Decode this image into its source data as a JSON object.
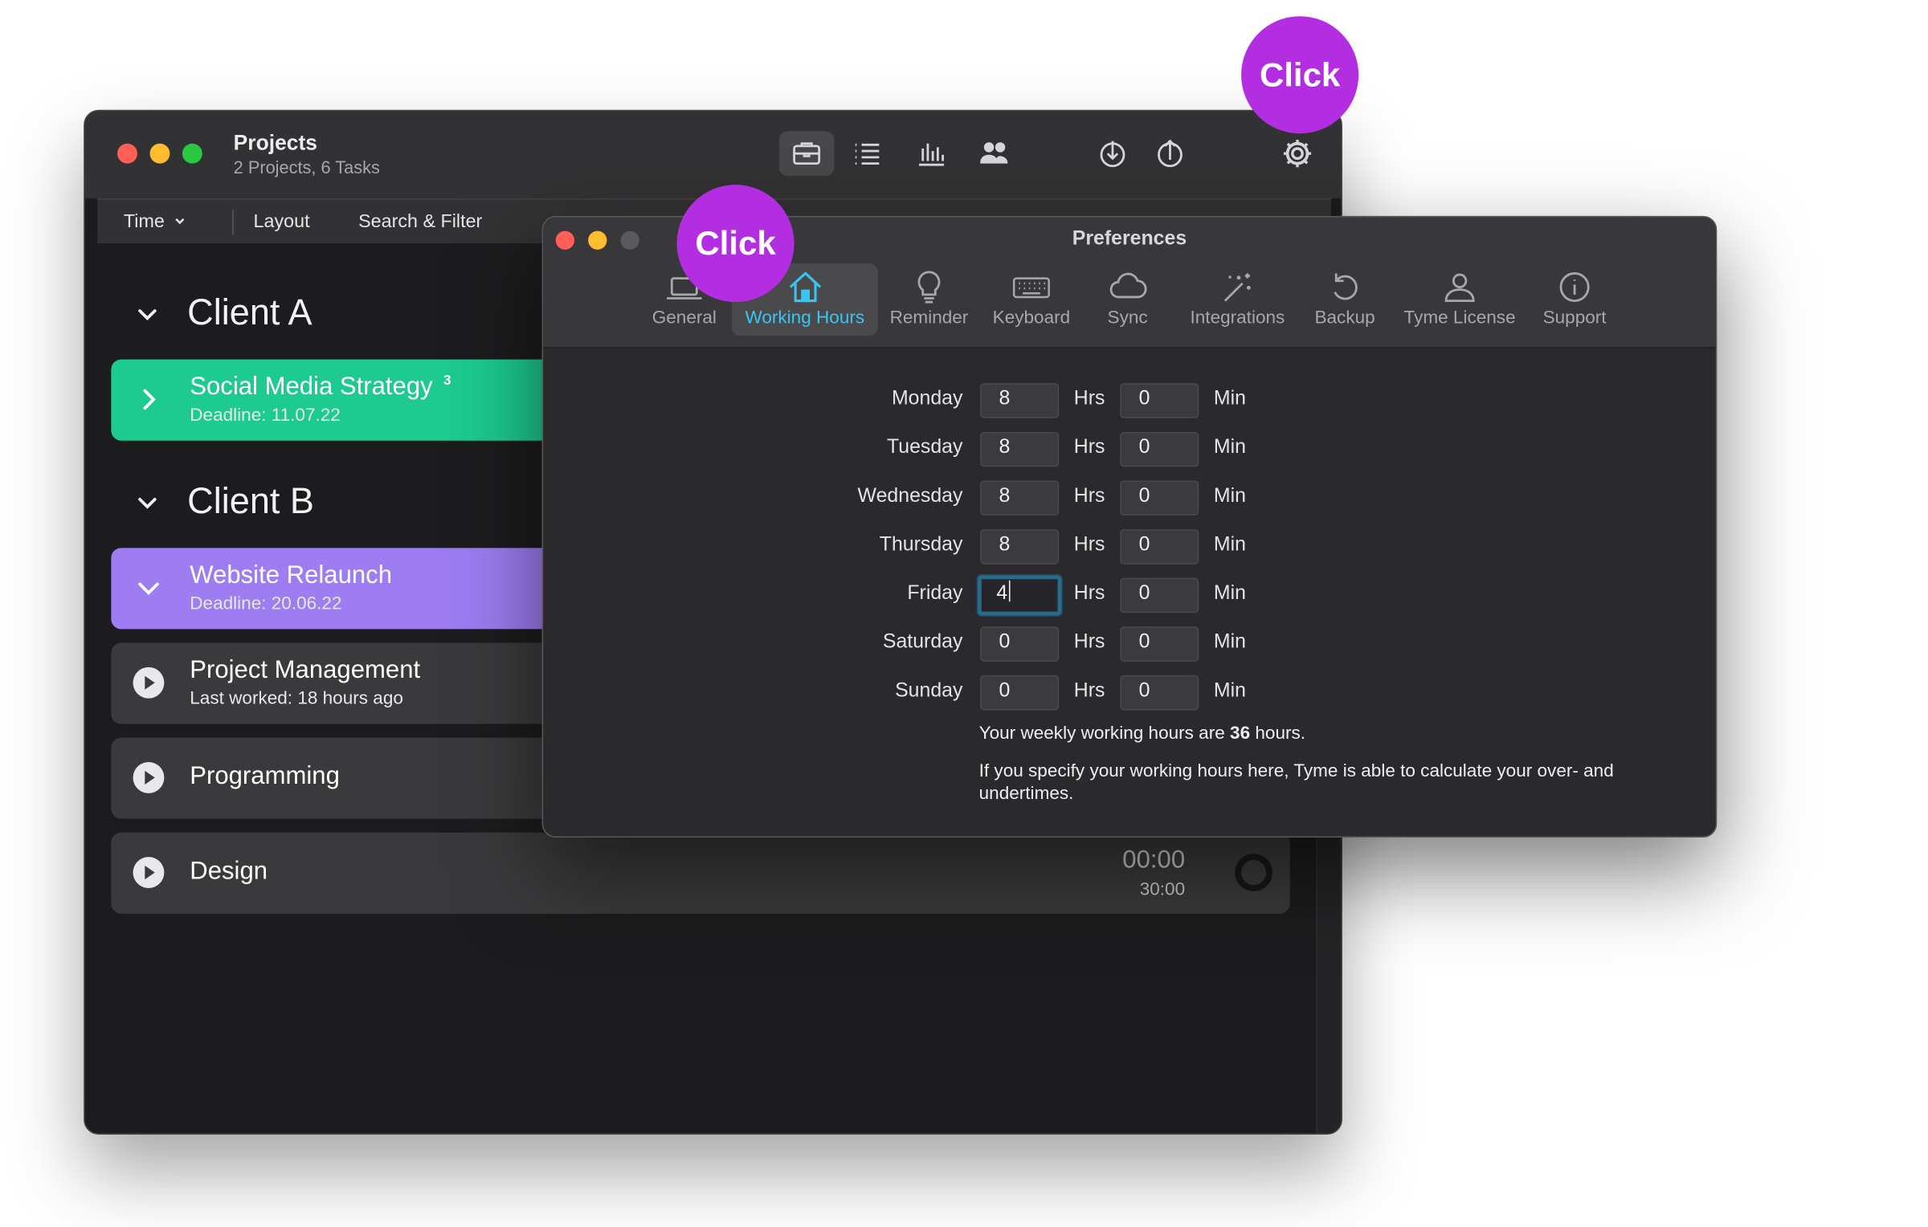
{
  "main_window": {
    "title": "Projects",
    "subtitle": "2 Projects, 6 Tasks",
    "traffic_colors": [
      "#ff5f57",
      "#febc2e",
      "#28c840"
    ],
    "toolbar_icons": [
      "briefcase-icon",
      "list-icon",
      "bar-chart-icon",
      "people-icon",
      "download-icon",
      "share-icon",
      "gear-icon"
    ],
    "subbar": {
      "time_label": "Time",
      "layout_label": "Layout",
      "search_label": "Search & Filter"
    },
    "groups": [
      {
        "title": "Client A",
        "projects": [
          {
            "title": "Social Media Strategy",
            "badge": "3",
            "subtitle": "Deadline: 11.07.22",
            "color": "#1dca8f"
          }
        ]
      },
      {
        "title": "Client B",
        "projects": [
          {
            "title": "Website Relaunch",
            "subtitle": "Deadline: 20.06.22",
            "color": "#9d7df1"
          }
        ],
        "tasks": [
          {
            "title": "Project Management",
            "subtitle": "Last worked: 18 hours ago"
          },
          {
            "title": "Programming"
          },
          {
            "title": "Design",
            "time": "00:00",
            "budget": "30:00"
          }
        ]
      }
    ]
  },
  "preferences": {
    "title": "Preferences",
    "accent_color": "#35c6f4",
    "tabs": [
      {
        "label": "General",
        "icon": "laptop-icon"
      },
      {
        "label": "Working Hours",
        "icon": "house-icon",
        "active": true
      },
      {
        "label": "Reminder",
        "icon": "lightbulb-icon"
      },
      {
        "label": "Keyboard",
        "icon": "keyboard-icon"
      },
      {
        "label": "Sync",
        "icon": "cloud-icon"
      },
      {
        "label": "Integrations",
        "icon": "magic-wand-icon"
      },
      {
        "label": "Backup",
        "icon": "restore-icon"
      },
      {
        "label": "Tyme License",
        "icon": "person-icon"
      },
      {
        "label": "Support",
        "icon": "info-icon"
      }
    ],
    "hours_unit": "Hrs",
    "min_unit": "Min",
    "days": [
      {
        "day": "Monday",
        "hours": "8",
        "minutes": "0"
      },
      {
        "day": "Tuesday",
        "hours": "8",
        "minutes": "0"
      },
      {
        "day": "Wednesday",
        "hours": "8",
        "minutes": "0"
      },
      {
        "day": "Thursday",
        "hours": "8",
        "minutes": "0"
      },
      {
        "day": "Friday",
        "hours": "4",
        "minutes": "0",
        "focused": true
      },
      {
        "day": "Saturday",
        "hours": "0",
        "minutes": "0"
      },
      {
        "day": "Sunday",
        "hours": "0",
        "minutes": "0"
      }
    ],
    "weekly_prefix": "Your weekly working hours are",
    "weekly_total": "36",
    "weekly_suffix": "hours.",
    "note": "If you specify your working hours here, Tyme is able to calculate your over- and undertimes."
  },
  "click_badges": [
    {
      "label": "Click",
      "target": "gear-icon"
    },
    {
      "label": "Click",
      "target": "Working Hours"
    }
  ],
  "click_badge_color": "#b32ee0"
}
